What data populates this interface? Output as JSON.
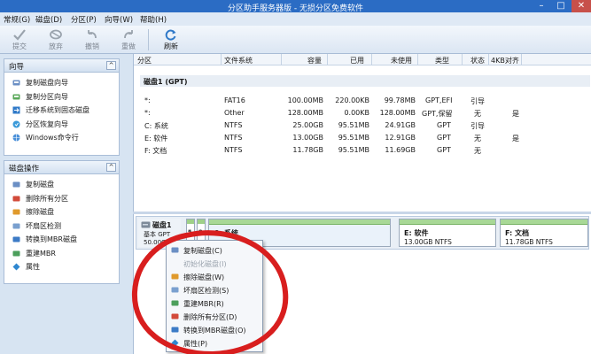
{
  "window": {
    "title": "分区助手服务器版 - 无损分区免费软件",
    "min": "–",
    "max": "□",
    "close": "✕"
  },
  "menu": [
    "常规(G)",
    "磁盘(D)",
    "分区(P)",
    "向导(W)",
    "帮助(H)"
  ],
  "toolbar": [
    {
      "label": "提交",
      "icon": "submit-icon"
    },
    {
      "label": "放弃",
      "icon": "discard-icon"
    },
    {
      "label": "撤销",
      "icon": "undo-icon"
    },
    {
      "label": "重做",
      "icon": "redo-icon"
    },
    {
      "label": "刷新",
      "icon": "refresh-icon"
    }
  ],
  "wizard_panel": {
    "title": "向导",
    "collapse": "^",
    "items": [
      "复制磁盘向导",
      "复制分区向导",
      "迁移系统到固态磁盘",
      "分区恢复向导",
      "Windows命令行"
    ]
  },
  "disk_ops_panel": {
    "title": "磁盘操作",
    "collapse": "^",
    "items": [
      "复制磁盘",
      "删除所有分区",
      "擦除磁盘",
      "坏扇区检测",
      "转换到MBR磁盘",
      "重建MBR",
      "属性"
    ]
  },
  "table": {
    "headers": [
      "分区",
      "文件系统",
      "容量",
      "已用",
      "未使用",
      "类型",
      "状态",
      "4KB对齐"
    ],
    "disk_label": "磁盘1 (GPT)",
    "rows": [
      [
        "*:",
        "FAT16",
        "100.00MB",
        "220.00KB",
        "99.78MB",
        "GPT,EFI",
        "引导",
        ""
      ],
      [
        "*:",
        "Other",
        "128.00MB",
        "0.00KB",
        "128.00MB",
        "GPT,保留",
        "无",
        "是"
      ],
      [
        "C: 系统",
        "NTFS",
        "25.00GB",
        "95.51MB",
        "24.91GB",
        "GPT",
        "引导",
        ""
      ],
      [
        "E: 软件",
        "NTFS",
        "13.00GB",
        "95.51MB",
        "12.91GB",
        "GPT",
        "无",
        "是"
      ],
      [
        "F: 文档",
        "NTFS",
        "11.78GB",
        "95.51MB",
        "11.69GB",
        "GPT",
        "无",
        ""
      ]
    ]
  },
  "diskmap": {
    "disk_name": "磁盘1",
    "disk_type": "基本 GPT",
    "disk_size": "50.00GB",
    "small_part_label": "*",
    "partitions": [
      {
        "name": "C: 系统",
        "info": ""
      },
      {
        "name": "E: 软件",
        "info": "13.00GB NTFS"
      },
      {
        "name": "F: 文档",
        "info": "11.78GB NTFS"
      }
    ]
  },
  "context_menu": [
    {
      "label": "复制磁盘(C)",
      "enabled": true,
      "icon": "copy-disk-icon"
    },
    {
      "label": "初始化磁盘(I)",
      "enabled": false,
      "icon": ""
    },
    {
      "label": "擦除磁盘(W)",
      "enabled": true,
      "icon": "wipe-disk-icon"
    },
    {
      "label": "坏扇区检测(S)",
      "enabled": true,
      "icon": "bad-sector-icon"
    },
    {
      "label": "重建MBR(R)",
      "enabled": true,
      "icon": "rebuild-mbr-icon"
    },
    {
      "label": "删除所有分区(D)",
      "enabled": true,
      "icon": "delete-partitions-icon"
    },
    {
      "label": "转换到MBR磁盘(O)",
      "enabled": true,
      "icon": "convert-mbr-icon"
    },
    {
      "label": "属性(P)",
      "enabled": true,
      "icon": "properties-icon"
    }
  ],
  "colors": {
    "titlebar": "#2b6cc4",
    "partition_bar": "#a8d896",
    "annotation": "#d81e1e"
  }
}
